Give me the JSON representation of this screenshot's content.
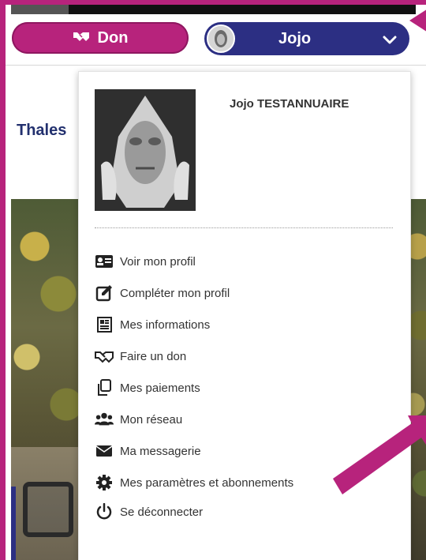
{
  "header": {
    "donate_label": "Don",
    "user_name": "Jojo"
  },
  "page": {
    "title_fragment": "Thales"
  },
  "dropdown": {
    "full_name": "Jojo TESTANNUAIRE",
    "items": [
      {
        "label": "Voir mon profil",
        "icon": "id-card-icon"
      },
      {
        "label": "Compléter mon profil",
        "icon": "edit-icon"
      },
      {
        "label": "Mes informations",
        "icon": "newspaper-icon"
      },
      {
        "label": "Faire un don",
        "icon": "handshake-icon"
      },
      {
        "label": "Mes paiements",
        "icon": "copy-icon"
      },
      {
        "label": "Mon réseau",
        "icon": "users-icon"
      },
      {
        "label": "Ma messagerie",
        "icon": "envelope-icon"
      },
      {
        "label": "Mes paramètres et abonnements",
        "icon": "gear-icon"
      },
      {
        "label": "Se déconnecter",
        "icon": "power-icon"
      }
    ]
  },
  "colors": {
    "accent_magenta": "#b7237c",
    "brand_navy": "#2c2f83",
    "title_navy": "#22306e"
  }
}
